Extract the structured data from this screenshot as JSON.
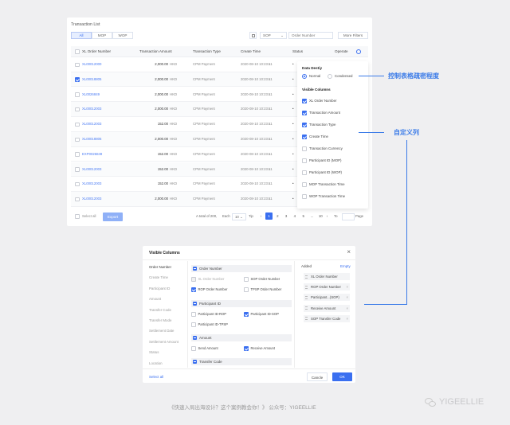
{
  "list": {
    "title": "Transaction List",
    "tabs": [
      "All",
      "MOP",
      "WOP"
    ],
    "filter_select": "SOP",
    "search_placeholder": "Order Number",
    "more_filters": "More Filters",
    "columns": [
      "XL Order Number",
      "Transaction Amount",
      "Transaction Type",
      "Create Time",
      "Status",
      "Operate"
    ],
    "rows": [
      {
        "order": "XL00012000",
        "amount": "2,000.00",
        "currency": "HKD",
        "type": "CPM Payment",
        "time": "2020-08-10 10:23:11",
        "checked": false
      },
      {
        "order": "XL00018805",
        "amount": "2,000.00",
        "currency": "HKD",
        "type": "CPM Payment",
        "time": "2020-08-10 10:23:11",
        "checked": true
      },
      {
        "order": "XL0026849",
        "amount": "2,000.00",
        "currency": "HKD",
        "type": "CPM Payment",
        "time": "2020-08-10 10:23:11",
        "checked": false
      },
      {
        "order": "XL00012003",
        "amount": "2,000.00",
        "currency": "HKD",
        "type": "CPM Payment",
        "time": "2020-08-10 10:23:11",
        "checked": false
      },
      {
        "order": "XL00012003",
        "amount": "152.00",
        "currency": "HKD",
        "type": "CPM Payment",
        "time": "2020-08-10 10:23:11",
        "checked": false
      },
      {
        "order": "XL00018805",
        "amount": "2,000.00",
        "currency": "HKD",
        "type": "CPM Payment",
        "time": "2020-08-10 10:23:11",
        "checked": false
      },
      {
        "order": "EXP0026849",
        "amount": "152.00",
        "currency": "HKD",
        "type": "CPM Payment",
        "time": "2020-08-10 10:23:11",
        "checked": false
      },
      {
        "order": "XL00012003",
        "amount": "152.00",
        "currency": "HKD",
        "type": "CPM Payment",
        "time": "2020-08-10 10:23:11",
        "checked": false
      },
      {
        "order": "XL00012003",
        "amount": "152.00",
        "currency": "HKD",
        "type": "CPM Payment",
        "time": "2020-08-10 10:23:11",
        "checked": false
      },
      {
        "order": "XL00012003",
        "amount": "2,000.00",
        "currency": "HKD",
        "type": "CPM Payment",
        "time": "2020-08-10 10:23:11",
        "checked": false
      }
    ],
    "select_all": "Select all",
    "export": "Export",
    "pagination": {
      "total": "A total of 200,",
      "each": "Each",
      "per_page": "10",
      "tip": "Tip",
      "pages": [
        "1",
        "2",
        "3",
        "4",
        "5",
        "...",
        "10"
      ],
      "to": "To",
      "page": "Page"
    }
  },
  "settings": {
    "density_title": "Data Destiy",
    "density_options": [
      "Normal",
      "Condensed"
    ],
    "visible_title": "Visible Columns",
    "items": [
      {
        "label": "XL Order Number",
        "checked": true
      },
      {
        "label": "Transaction Amount",
        "checked": true
      },
      {
        "label": "Transaction Type",
        "checked": true
      },
      {
        "label": "Create Time",
        "checked": true
      },
      {
        "label": "Transaction Currency",
        "checked": false
      },
      {
        "label": "Participant ID (MOP)",
        "checked": false
      },
      {
        "label": "Participant ID (WOP)",
        "checked": false
      },
      {
        "label": "MOP Transaction Time",
        "checked": false
      },
      {
        "label": "WOP Transaction Time",
        "checked": false
      }
    ]
  },
  "callouts": {
    "density": "控制表格疏密程度",
    "custom": "自定义列"
  },
  "modal": {
    "title": "Visible Columns",
    "nav": [
      "Order Number",
      "Create Time",
      "Participant ID",
      "Amount",
      "Transfer Code",
      "Transfer Mode",
      "Settlement Date",
      "Settlement Amount",
      "Status",
      "Location"
    ],
    "groups": {
      "order_number": "Order Number",
      "participant": "Participant ID",
      "amount": "Amount",
      "transfer": "Transfer Code"
    },
    "options": {
      "xl": "XL Order Number",
      "sop": "SOP Order Number",
      "rop": "ROP Order Number",
      "tpsp": "TPSP Order Number",
      "p_rop": "Participant ID-ROP",
      "p_sop": "Participant ID-SOP",
      "p_tpsp": "Participant ID-TPSP",
      "send": "Send Amount",
      "receive": "Receive Amount"
    },
    "added_title": "Added",
    "empty": "Empty",
    "added": [
      "XL Order Number",
      "ROP Order Number",
      "Participant...(SOP)",
      "Receive Amount",
      "SOP Transfer Code"
    ],
    "select_all": "Select all",
    "cancel": "Cancle",
    "ok": "OK"
  },
  "watermark": {
    "caption": "《快速入局出海设计？这个案例教会你！》 公众号：YIGEELLIE",
    "logo": "YIGEELLIE"
  },
  "colors": {
    "accent": "#3a6ff0",
    "callout": "#3b7be8"
  }
}
